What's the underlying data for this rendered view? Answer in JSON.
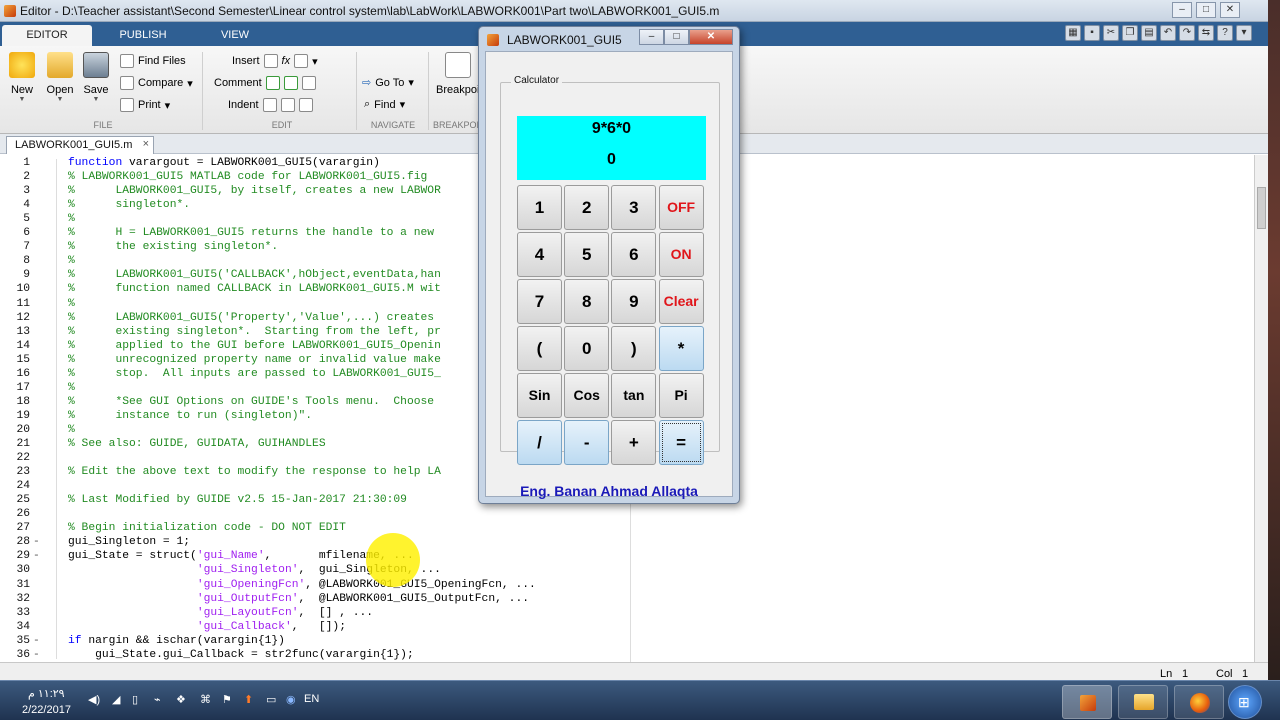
{
  "editor": {
    "window_title": "Editor - D:\\Teacher assistant\\Second Semester\\Linear control system\\lab\\LabWork\\LABWORK001\\Part two\\LABWORK001_GUI5.m",
    "tabs": [
      "EDITOR",
      "PUBLISH",
      "VIEW"
    ],
    "ribbon": {
      "new": "New",
      "open": "Open",
      "save": "Save",
      "find_files": "Find Files",
      "compare": "Compare",
      "print": "Print",
      "insert": "Insert",
      "comment": "Comment",
      "indent": "Indent",
      "go_to": "Go To",
      "find": "Find",
      "breakpoints": "Breakpoints",
      "groups": {
        "file": "FILE",
        "edit": "EDIT",
        "navigate": "NAVIGATE",
        "breakpoints": "BREAKPOI"
      }
    },
    "file_tab": "LABWORK001_GUI5.m",
    "status": {
      "ln_label": "Ln",
      "ln": "1",
      "col_label": "Col",
      "col": "1"
    },
    "code_lines": [
      {
        "n": "1",
        "dash": "",
        "text": "function varargout = LABWORK001_GUI5(varargin)"
      },
      {
        "n": "2",
        "dash": "",
        "text": "% LABWORK001_GUI5 MATLAB code for LABWORK001_GUI5.fig"
      },
      {
        "n": "3",
        "dash": "",
        "text": "%      LABWORK001_GUI5, by itself, creates a new LABWOR"
      },
      {
        "n": "4",
        "dash": "",
        "text": "%      singleton*."
      },
      {
        "n": "5",
        "dash": "",
        "text": "%"
      },
      {
        "n": "6",
        "dash": "",
        "text": "%      H = LABWORK001_GUI5 returns the handle to a new"
      },
      {
        "n": "7",
        "dash": "",
        "text": "%      the existing singleton*."
      },
      {
        "n": "8",
        "dash": "",
        "text": "%"
      },
      {
        "n": "9",
        "dash": "",
        "text": "%      LABWORK001_GUI5('CALLBACK',hObject,eventData,han"
      },
      {
        "n": "10",
        "dash": "",
        "text": "%      function named CALLBACK in LABWORK001_GUI5.M wit"
      },
      {
        "n": "11",
        "dash": "",
        "text": "%"
      },
      {
        "n": "12",
        "dash": "",
        "text": "%      LABWORK001_GUI5('Property','Value',...) creates"
      },
      {
        "n": "13",
        "dash": "",
        "text": "%      existing singleton*.  Starting from the left, pr"
      },
      {
        "n": "14",
        "dash": "",
        "text": "%      applied to the GUI before LABWORK001_GUI5_Openin"
      },
      {
        "n": "15",
        "dash": "",
        "text": "%      unrecognized property name or invalid value make"
      },
      {
        "n": "16",
        "dash": "",
        "text": "%      stop.  All inputs are passed to LABWORK001_GUI5_"
      },
      {
        "n": "17",
        "dash": "",
        "text": "%"
      },
      {
        "n": "18",
        "dash": "",
        "text": "%      *See GUI Options on GUIDE's Tools menu.  Choose"
      },
      {
        "n": "19",
        "dash": "",
        "text": "%      instance to run (singleton)\"."
      },
      {
        "n": "20",
        "dash": "",
        "text": "%"
      },
      {
        "n": "21",
        "dash": "",
        "text": "% See also: GUIDE, GUIDATA, GUIHANDLES"
      },
      {
        "n": "22",
        "dash": "",
        "text": ""
      },
      {
        "n": "23",
        "dash": "",
        "text": "% Edit the above text to modify the response to help LA"
      },
      {
        "n": "24",
        "dash": "",
        "text": ""
      },
      {
        "n": "25",
        "dash": "",
        "text": "% Last Modified by GUIDE v2.5 15-Jan-2017 21:30:09"
      },
      {
        "n": "26",
        "dash": "",
        "text": ""
      },
      {
        "n": "27",
        "dash": "",
        "text": "% Begin initialization code - DO NOT EDIT"
      },
      {
        "n": "28",
        "dash": "-",
        "text": "gui_Singleton = 1;"
      },
      {
        "n": "29",
        "dash": "-",
        "text": "gui_State = struct('gui_Name',       mfilename, ..."
      },
      {
        "n": "30",
        "dash": "",
        "text": "                   'gui_Singleton',  gui_Singleton, ..."
      },
      {
        "n": "31",
        "dash": "",
        "text": "                   'gui_OpeningFcn', @LABWORK001_GUI5_OpeningFcn, ..."
      },
      {
        "n": "32",
        "dash": "",
        "text": "                   'gui_OutputFcn',  @LABWORK001_GUI5_OutputFcn, ..."
      },
      {
        "n": "33",
        "dash": "",
        "text": "                   'gui_LayoutFcn',  [] , ..."
      },
      {
        "n": "34",
        "dash": "",
        "text": "                   'gui_Callback',   []);"
      },
      {
        "n": "35",
        "dash": "-",
        "text": "if nargin && ischar(varargin{1})"
      },
      {
        "n": "36",
        "dash": "-",
        "text": "    gui_State.gui_Callback = str2func(varargin{1});"
      }
    ]
  },
  "gui": {
    "window_title": "LABWORK001_GUI5",
    "panel_title": "Calculator",
    "expression": "9*6*0",
    "result": "0",
    "buttons": [
      [
        "1",
        "2",
        "3",
        "OFF"
      ],
      [
        "4",
        "5",
        "6",
        "ON"
      ],
      [
        "7",
        "8",
        "9",
        "Clear"
      ],
      [
        "(",
        "0",
        ")",
        "*"
      ],
      [
        "Sin",
        "Cos",
        "tan",
        "Pi"
      ],
      [
        "/",
        "-",
        "+",
        "="
      ]
    ],
    "credit": "Eng. Banan Ahmad Allaqta"
  },
  "taskbar": {
    "time": "١١:٢٩ م",
    "date": "2/22/2017",
    "language": "EN"
  },
  "colors": {
    "display": "#00ffff",
    "accent_red": "#e0151a",
    "credit": "#1a1ab8",
    "comment": "#228b22",
    "string": "#a020f0",
    "keyword": "#0000ff"
  }
}
